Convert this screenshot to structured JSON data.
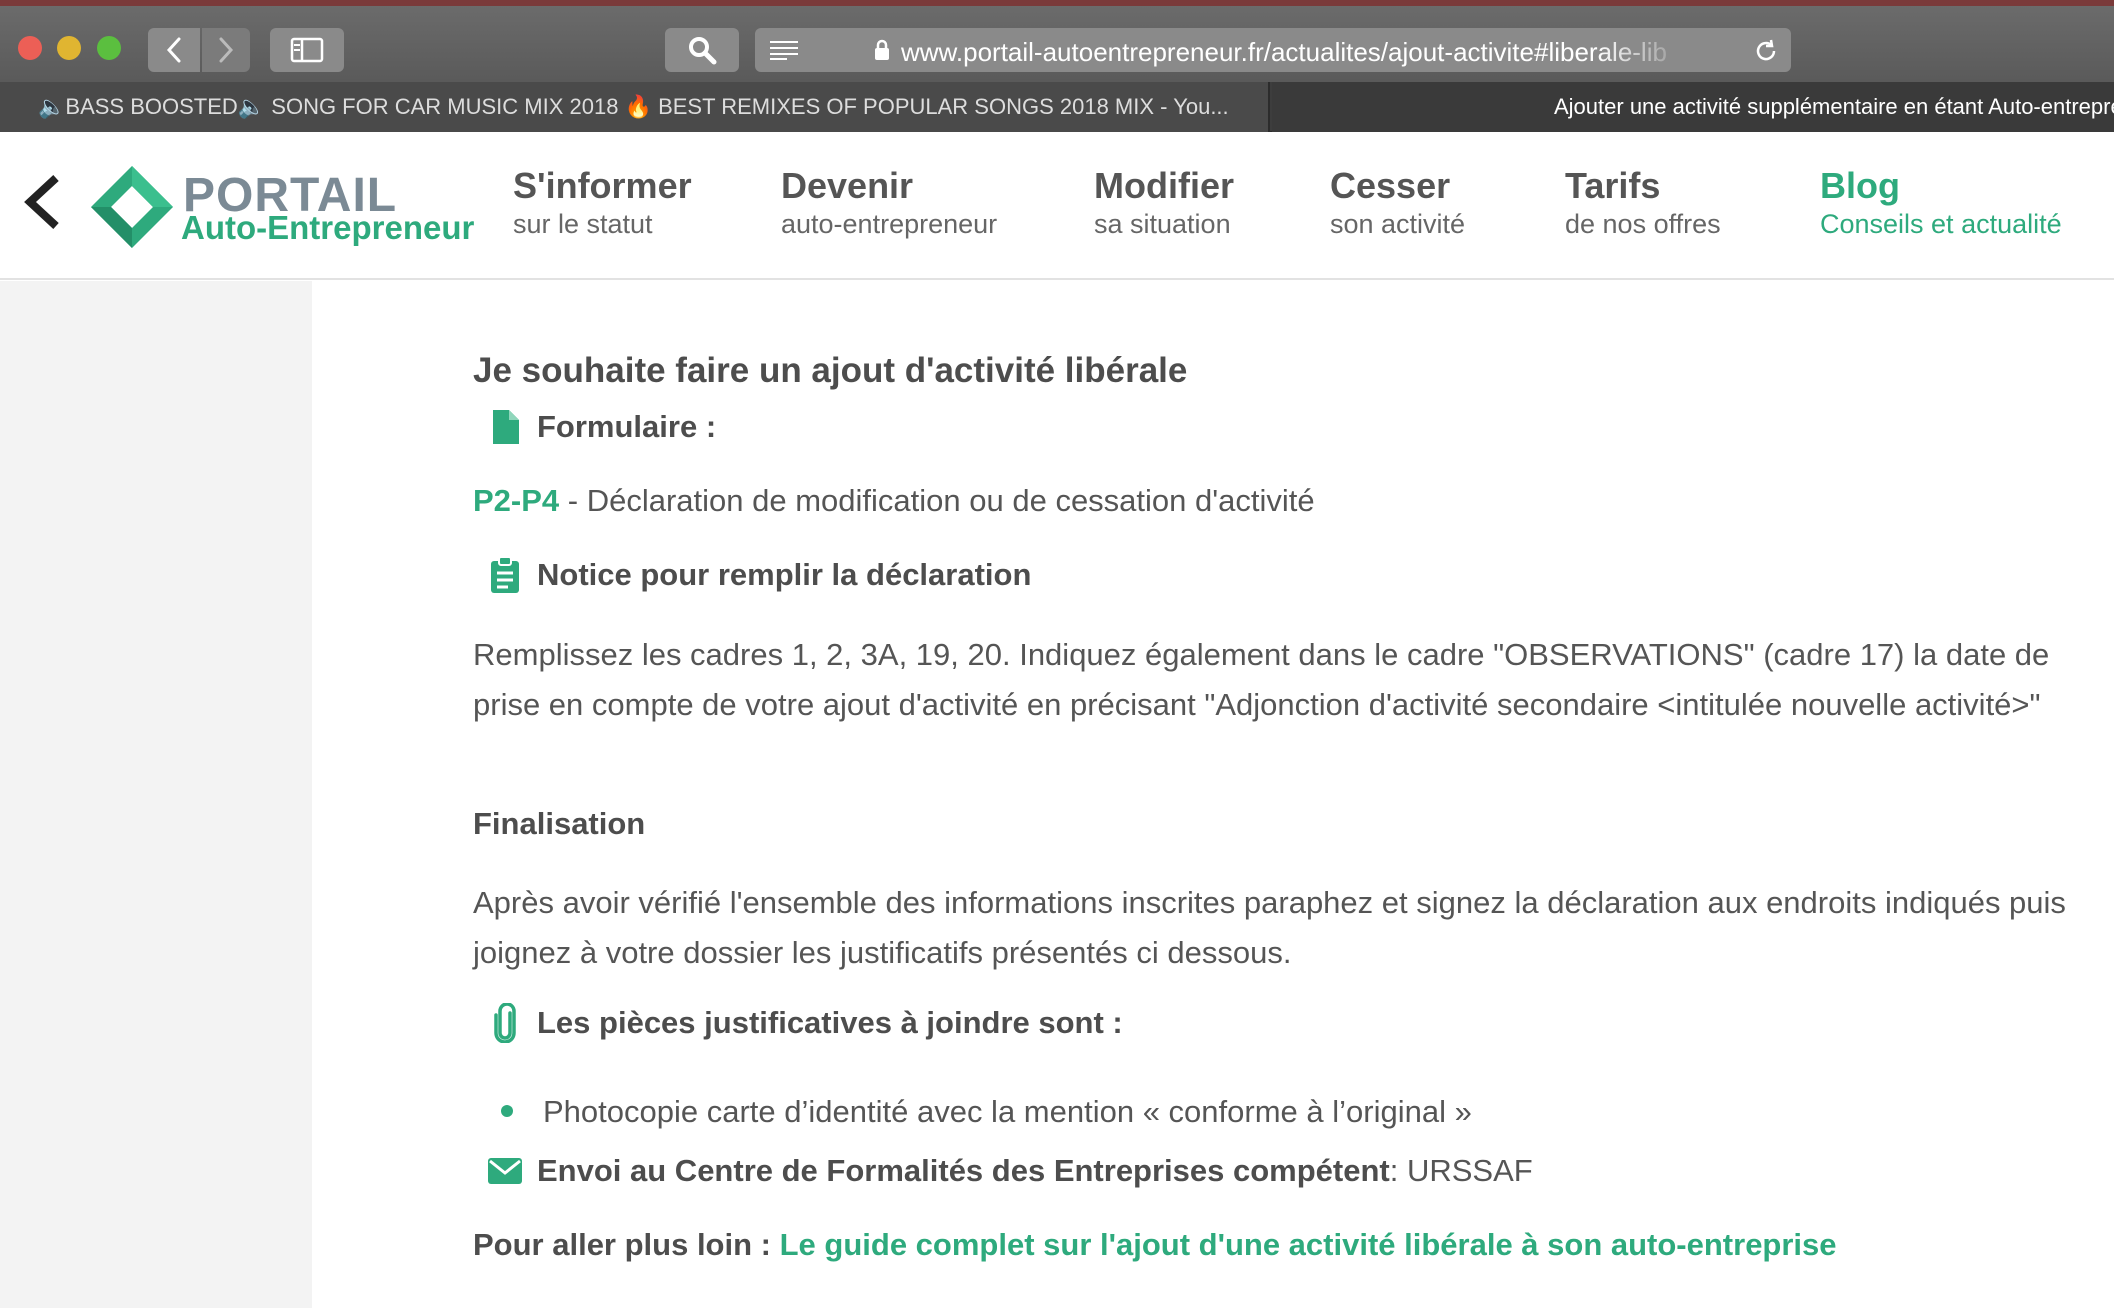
{
  "browser": {
    "url": "www.portail-autoentrepreneur.fr/actualites/ajout-activite#liberale-lib",
    "tabs": [
      {
        "title": "🔈BASS BOOSTED🔈 SONG FOR CAR MUSIC MIX 2018 🔥 BEST REMIXES OF POPULAR SONGS 2018 MIX - You..."
      },
      {
        "title": "Ajouter une activité supplémentaire en étant Auto-entrepreneur"
      }
    ]
  },
  "logo": {
    "line1": "PORTAIL",
    "line2": "Auto-Entrepreneur",
    "color": "#2eaa7d"
  },
  "nav": [
    {
      "title": "S'informer",
      "subtitle": "sur le statut"
    },
    {
      "title": "Devenir",
      "subtitle": "auto-entrepreneur"
    },
    {
      "title": "Modifier",
      "subtitle": "sa situation"
    },
    {
      "title": "Cesser",
      "subtitle": "son activité"
    },
    {
      "title": "Tarifs",
      "subtitle": "de nos offres"
    },
    {
      "title": "Blog",
      "subtitle": "Conseils et actualité",
      "active": true
    }
  ],
  "content": {
    "heading": "Je souhaite faire un ajout d'activité libérale",
    "formulaire_label": "Formulaire :",
    "form_code": "P2-P4",
    "form_desc": " - Déclaration de modification ou de cessation d'activité",
    "notice_label": "Notice pour remplir la déclaration",
    "notice_text": "Remplissez les cadres 1, 2, 3A, 19, 20. Indiquez également dans le cadre \"OBSERVATIONS\" (cadre 17) la date de prise en compte de votre ajout d'activité en précisant  \"Adjonction d'activité secondaire <intitulée nouvelle activité>\"",
    "finalisation_label": "Finalisation",
    "finalisation_text": "Après avoir vérifié l'ensemble des informations inscrites paraphez et signez la déclaration aux endroits indiqués puis joignez à votre dossier les justificatifs présentés ci dessous.",
    "pieces_label": "Les pièces justificatives à joindre sont :",
    "pieces": [
      "Photocopie carte d’identité avec la mention « conforme à l’original »"
    ],
    "envoi_label": "Envoi au Centre de Formalités des Entreprises compétent",
    "envoi_value": " : URSSAF",
    "plus_loin_label": "Pour aller plus loin : ",
    "plus_loin_link": "Le guide complet sur l'ajout d'une activité libérale à son auto-entreprise"
  }
}
